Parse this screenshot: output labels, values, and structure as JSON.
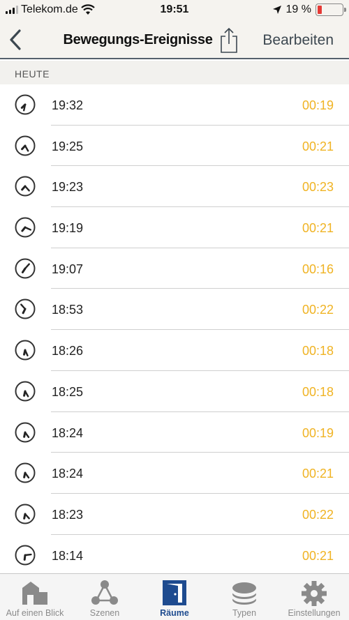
{
  "status_bar": {
    "carrier": "Telekom.de",
    "time": "19:51",
    "battery": "19 %"
  },
  "nav": {
    "title": "Bewegungs-Ereignisse",
    "edit_label": "Bearbeiten"
  },
  "section": {
    "header": "HEUTE"
  },
  "events": [
    {
      "time": "19:32",
      "duration": "00:19"
    },
    {
      "time": "19:25",
      "duration": "00:21"
    },
    {
      "time": "19:23",
      "duration": "00:23"
    },
    {
      "time": "19:19",
      "duration": "00:21"
    },
    {
      "time": "19:07",
      "duration": "00:16"
    },
    {
      "time": "18:53",
      "duration": "00:22"
    },
    {
      "time": "18:26",
      "duration": "00:18"
    },
    {
      "time": "18:25",
      "duration": "00:18"
    },
    {
      "time": "18:24",
      "duration": "00:19"
    },
    {
      "time": "18:24",
      "duration": "00:21"
    },
    {
      "time": "18:23",
      "duration": "00:22"
    },
    {
      "time": "18:14",
      "duration": "00:21"
    }
  ],
  "tabs": [
    {
      "label": "Auf einen Blick",
      "icon": "house-icon"
    },
    {
      "label": "Szenen",
      "icon": "scenes-icon"
    },
    {
      "label": "Räume",
      "icon": "door-icon"
    },
    {
      "label": "Typen",
      "icon": "layers-icon"
    },
    {
      "label": "Einstellungen",
      "icon": "gear-icon"
    }
  ],
  "colors": {
    "accent_active": "#1e4b8f",
    "duration": "#f0b323",
    "battery_low": "#e53935"
  }
}
